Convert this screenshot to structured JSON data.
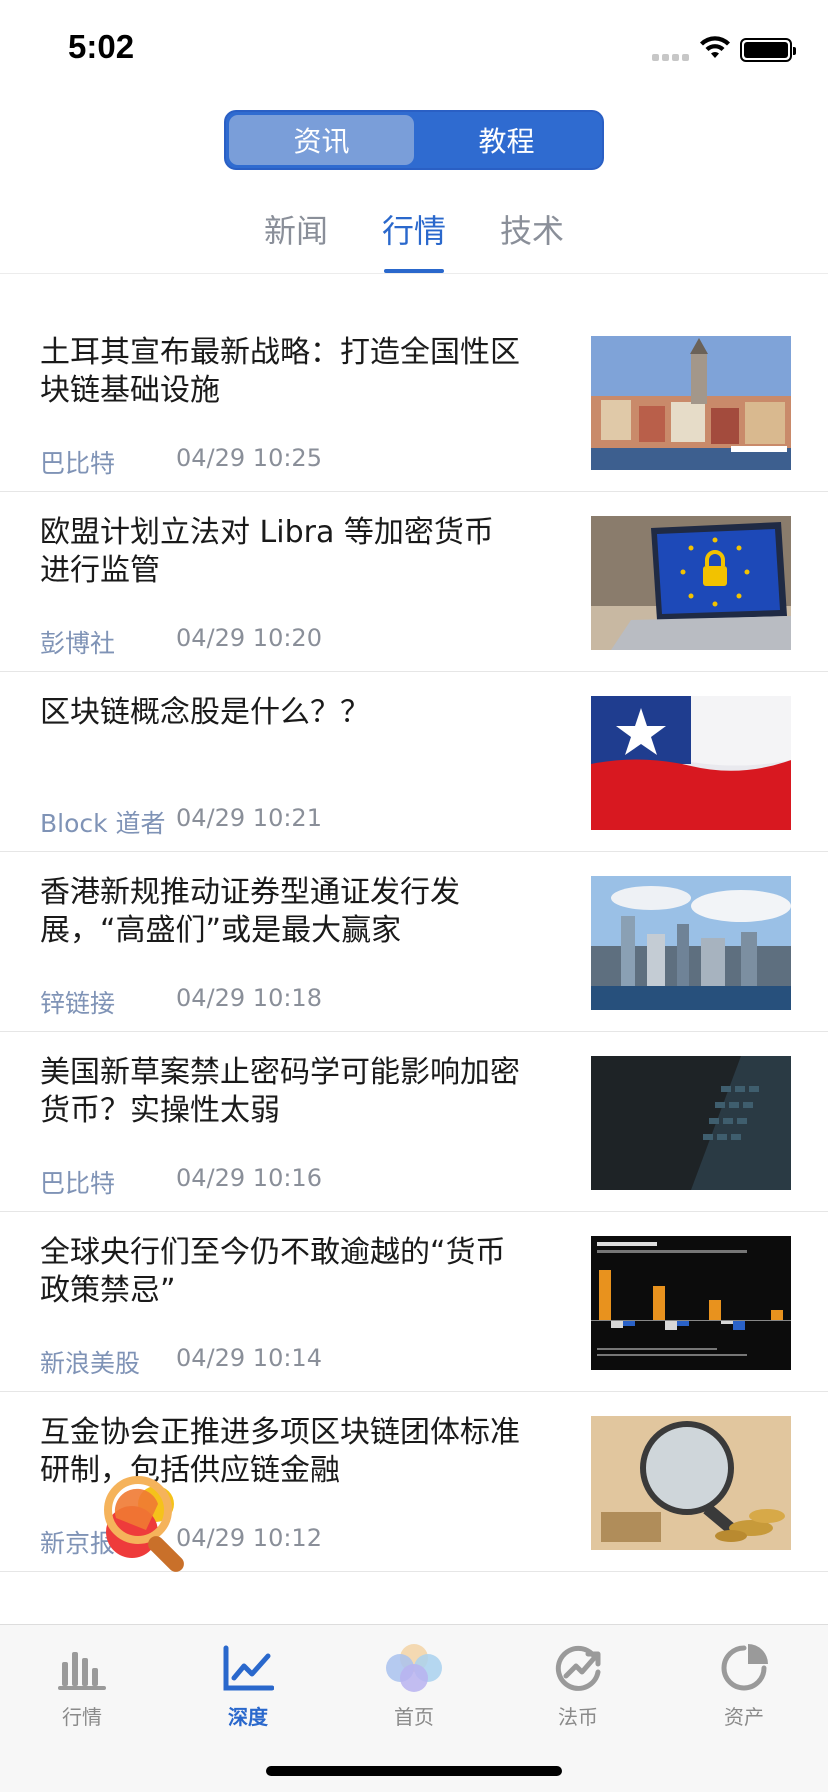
{
  "status": {
    "time": "5:02"
  },
  "segmented": {
    "left": "资讯",
    "right": "教程"
  },
  "category_tabs": [
    {
      "label": "新闻"
    },
    {
      "label": "行情"
    },
    {
      "label": "技术"
    }
  ],
  "news": [
    {
      "title": "土耳其宣布最新战略：打造全国性区块链基础设施",
      "source": "巴比特",
      "date": "04/29  10:25",
      "thumb": "istanbul-city-image"
    },
    {
      "title": "欧盟计划立法对 Libra 等加密货币进行监管",
      "source": "彭博社",
      "date": "04/29  10:20",
      "thumb": "eu-laptop-lock-image"
    },
    {
      "title": "区块链概念股是什么？？",
      "source": "Block 道者",
      "date": "04/29  10:21",
      "thumb": "chile-flag-image"
    },
    {
      "title": "香港新规推动证券型通证发行发展，“高盛们”或是最大赢家",
      "source": "锌链接",
      "date": "04/29  10:18",
      "thumb": "hong-kong-skyline-image"
    },
    {
      "title": "美国新草案禁止密码学可能影响加密货币？实操性太弱",
      "source": "巴比特",
      "date": "04/29  10:16",
      "thumb": "dark-keyboard-image"
    },
    {
      "title": "全球央行们至今仍不敢逾越的“货币政策禁忌”",
      "source": "新浪美股",
      "date": "04/29  10:14",
      "thumb": "borrowing-chart-image"
    },
    {
      "title": "互金协会正推进多项区块链团体标准研制，包括供应链金融",
      "source": "新京报",
      "date": "04/29  10:12",
      "thumb": "finance-regulation-image"
    }
  ],
  "tab_bar": [
    {
      "label": "行情",
      "icon": "bar-chart-icon"
    },
    {
      "label": "深度",
      "icon": "line-chart-icon"
    },
    {
      "label": "首页",
      "icon": "circles-icon"
    },
    {
      "label": "法币",
      "icon": "trend-circle-icon"
    },
    {
      "label": "资产",
      "icon": "pie-chart-icon"
    }
  ],
  "colors": {
    "accent": "#2a68cc",
    "segmented_bg": "#2f6bd0",
    "segmented_active": "#7a9ed9",
    "source_text": "#7f93b6"
  }
}
